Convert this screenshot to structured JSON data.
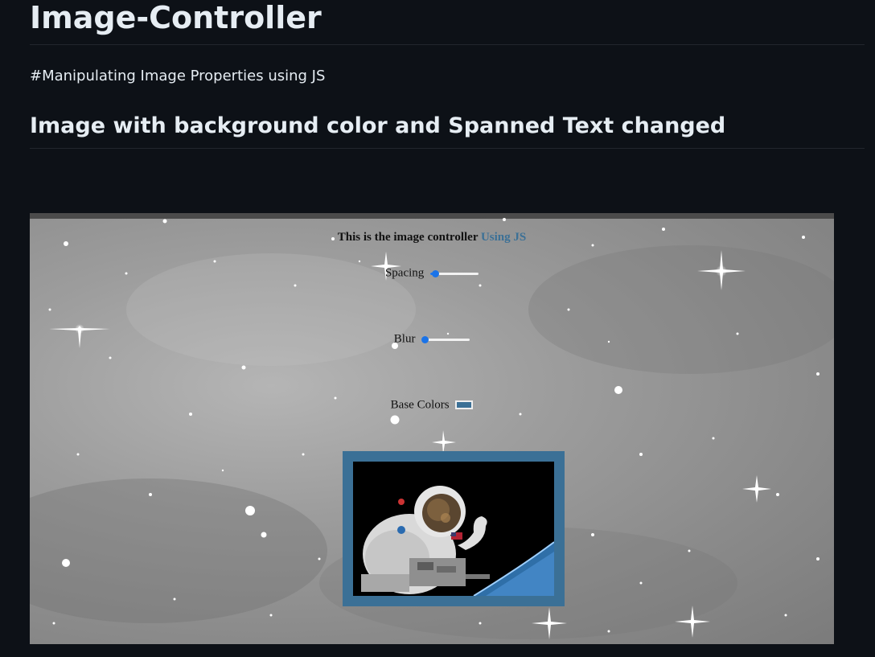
{
  "readme": {
    "title": "Image-Controller",
    "tagline": "#Manipulating Image Properties using JS",
    "section_heading": "Image with background color and Spanned Text changed"
  },
  "demo": {
    "heading_text": "This is the image controller ",
    "heading_accent": "Using JS",
    "controls": {
      "spacing_label": "Spacing",
      "spacing_value": 0.1,
      "blur_label": "Blur",
      "blur_value": 0.0,
      "base_colors_label": "Base Colors",
      "base_color_value": "#3b7096"
    },
    "image_icon": "astronaut-photo"
  },
  "colors": {
    "page_background": "#0d1117",
    "text": "#e6edf3",
    "accent": "#3b7096",
    "slider_accent": "#1a73e8"
  }
}
